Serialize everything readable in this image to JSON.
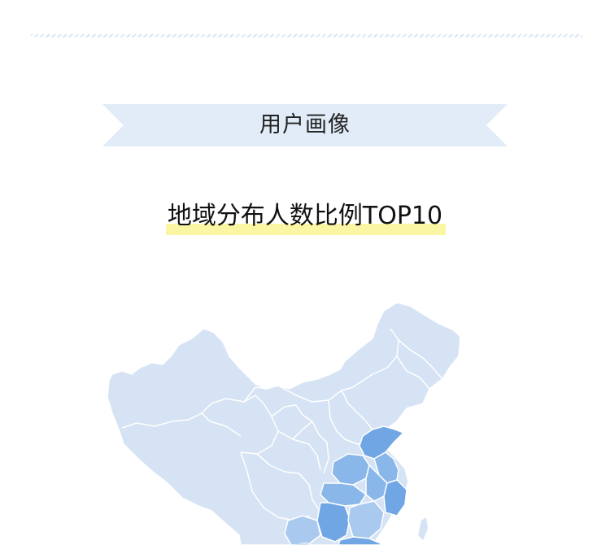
{
  "section": {
    "title": "用户画像"
  },
  "chart": {
    "title": "地域分布人数比例TOP10",
    "map_colors": {
      "base": "#d6e3f4",
      "light": "#a9c9ef",
      "medium": "#8ab7ea",
      "dark": "#6fa6e3",
      "border": "#ffffff"
    }
  }
}
